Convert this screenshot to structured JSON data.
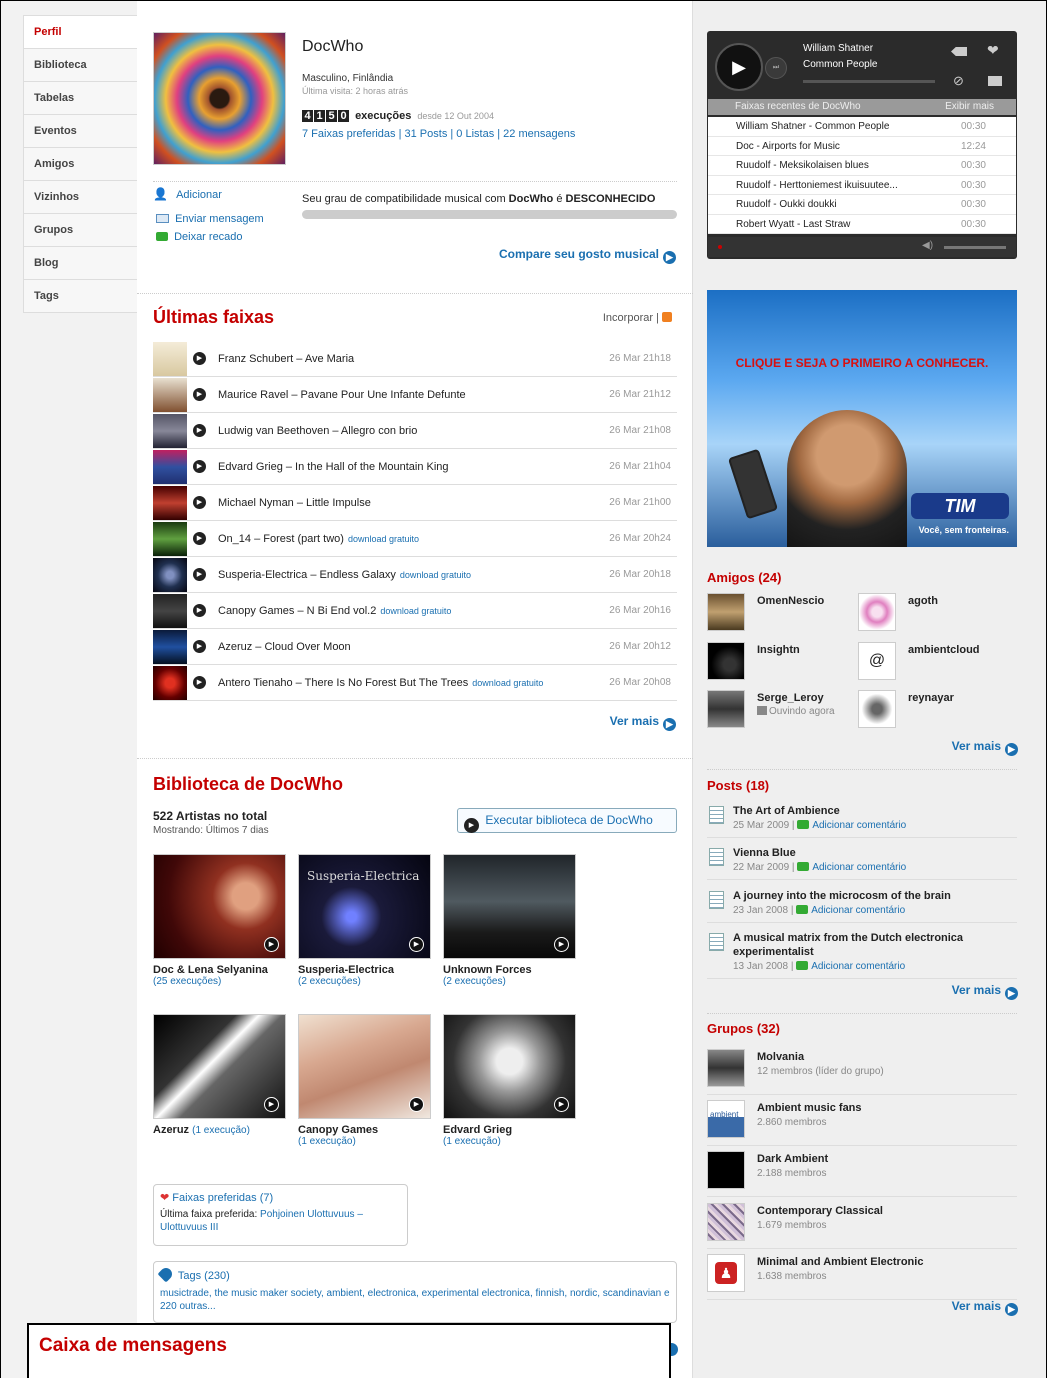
{
  "nav": [
    "Perfil",
    "Biblioteca",
    "Tabelas",
    "Eventos",
    "Amigos",
    "Vizinhos",
    "Grupos",
    "Blog",
    "Tags"
  ],
  "profile": {
    "username": "DocWho",
    "info": "Masculino, Finlândia",
    "last_visit": "Última visita: 2 horas atrás",
    "scrobble_digits": [
      "4",
      "1",
      "5",
      "0"
    ],
    "plays_label": "execuções",
    "since": "desde 12 Out 2004",
    "links": "7 Faixas preferidas | 31 Posts | 0 Listas | 22 mensagens",
    "actions": {
      "add": "Adicionar",
      "message": "Enviar mensagem",
      "shout": "Deixar recado"
    },
    "compat_prefix": "Seu grau de compatibilidade musical com",
    "compat_user": "DocWho",
    "compat_mid": "é",
    "compat_value": "DESCONHECIDO",
    "compare": "Compare seu gosto musical"
  },
  "recent": {
    "title": "Últimas faixas",
    "embed": "Incorporar |",
    "more": "Ver mais",
    "tracks": [
      {
        "title": "Franz Schubert – Ave Maria",
        "dl": "",
        "time": "26 Mar 21h18"
      },
      {
        "title": "Maurice Ravel – Pavane Pour Une Infante Defunte",
        "dl": "",
        "time": "26 Mar 21h12"
      },
      {
        "title": "Ludwig van Beethoven – Allegro con brio",
        "dl": "",
        "time": "26 Mar 21h08"
      },
      {
        "title": "Edvard Grieg – In the Hall of the Mountain King",
        "dl": "",
        "time": "26 Mar 21h04"
      },
      {
        "title": "Michael Nyman – Little Impulse",
        "dl": "",
        "time": "26 Mar 21h00"
      },
      {
        "title": "On_14 – Forest (part two)",
        "dl": "download gratuito",
        "time": "26 Mar 20h24"
      },
      {
        "title": "Susperia-Electrica – Endless Galaxy",
        "dl": "download gratuito",
        "time": "26 Mar 20h18"
      },
      {
        "title": "Canopy Games – N Bi End vol.2",
        "dl": "download gratuito",
        "time": "26 Mar 20h16"
      },
      {
        "title": "Azeruz – Cloud Over Moon",
        "dl": "",
        "time": "26 Mar 20h12"
      },
      {
        "title": "Antero Tienaho – There Is No Forest But The Trees",
        "dl": "download gratuito",
        "time": "26 Mar 20h08"
      }
    ]
  },
  "library": {
    "title": "Biblioteca de DocWho",
    "total": "522 Artistas no total",
    "showing": "Mostrando: Últimos 7 dias",
    "play_button": "Executar biblioteca de DocWho",
    "artists": [
      {
        "name": "Doc & Lena Selyanina",
        "plays": "(25 execuções)"
      },
      {
        "name": "Susperia-Electrica",
        "plays": "(2 execuções)",
        "img_text": "Susperia-Electrica"
      },
      {
        "name": "Unknown Forces",
        "plays": "(2 execuções)"
      },
      {
        "name": "Azeruz",
        "plays": "(1 execução)"
      },
      {
        "name": "Canopy Games",
        "plays": "(1 execução)"
      },
      {
        "name": "Edvard Grieg",
        "plays": "(1 execução)"
      }
    ]
  },
  "loved": {
    "title": "Faixas preferidas (7)",
    "last_label": "Última faixa preferida:",
    "last_track": "Pohjoinen Ulottuvuus – Ulottuvuus III"
  },
  "tags": {
    "title": "Tags (230)",
    "list": "musictrade, the music maker society, ambient, electronica, experimental electronica, finnish, nordic, scandinavian",
    "rest": "e 220 outras..."
  },
  "inbox": {
    "title": "Caixa de mensagens"
  },
  "player": {
    "artist": "William Shatner",
    "track": "Common People",
    "header": "Faixas recentes de DocWho",
    "show_more": "Exibir mais",
    "items": [
      {
        "t": "William Shatner - Common People",
        "d": "00:30"
      },
      {
        "t": "Doc - Airports for Music",
        "d": "12:24"
      },
      {
        "t": "Ruudolf - Meksikolaisen blues",
        "d": "00:30"
      },
      {
        "t": "Ruudolf - Herttoniemest ikuisuutee...",
        "d": "00:30"
      },
      {
        "t": "Ruudolf - Oukki doukki",
        "d": "00:30"
      },
      {
        "t": "Robert Wyatt - Last Straw",
        "d": "00:30"
      }
    ]
  },
  "ad": {
    "headline": "CLIQUE E SEJA O PRIMEIRO A CONHECER.",
    "brand": "TIM",
    "slogan": "Você, sem fronteiras."
  },
  "friends": {
    "title": "Amigos (24)",
    "more": "Ver mais",
    "list": [
      {
        "name": "OmenNescio",
        "status": ""
      },
      {
        "name": "agoth",
        "status": ""
      },
      {
        "name": "Insightn",
        "status": ""
      },
      {
        "name": "ambientcloud",
        "status": ""
      },
      {
        "name": "Serge_Leroy",
        "status": "Ouvindo agora"
      },
      {
        "name": "reynayar",
        "status": ""
      }
    ]
  },
  "posts": {
    "title": "Posts (18)",
    "more": "Ver mais",
    "comment": "Adicionar comentário",
    "list": [
      {
        "title": "The Art of Ambience",
        "date": "25 Mar 2009 |"
      },
      {
        "title": "Vienna Blue",
        "date": "22 Mar 2009 |"
      },
      {
        "title": "A journey into the microcosm of the brain",
        "date": "23 Jan 2008 |"
      },
      {
        "title": "A musical matrix from the Dutch electronica experimentalist",
        "date": "13 Jan 2008 |"
      }
    ]
  },
  "groups": {
    "title": "Grupos (32)",
    "more": "Ver mais",
    "list": [
      {
        "name": "Molvania",
        "members": "12 membros (líder do grupo)"
      },
      {
        "name": "Ambient music fans",
        "members": "2.860 membros",
        "img_text": "ambient"
      },
      {
        "name": "Dark Ambient",
        "members": "2.188 membros"
      },
      {
        "name": "Contemporary Classical",
        "members": "1.679 membros"
      },
      {
        "name": "Minimal and Ambient Electronic",
        "members": "1.638 membros"
      }
    ]
  }
}
